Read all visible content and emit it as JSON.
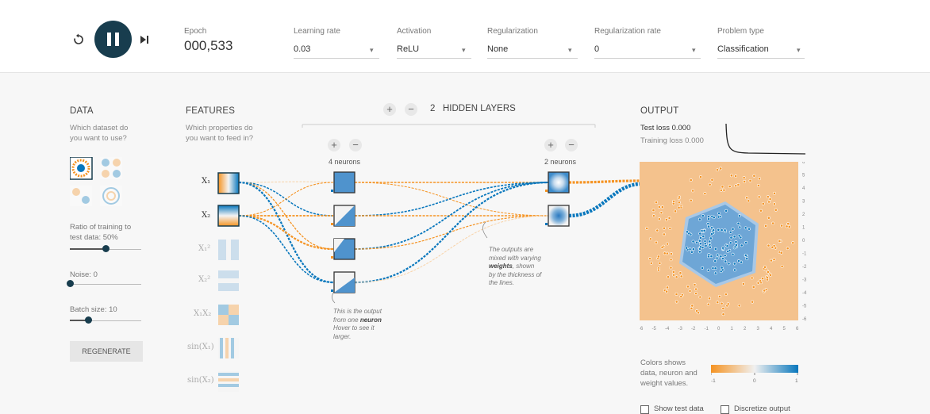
{
  "controls": {
    "reset_icon": "reset-icon",
    "play_pause_icon": "pause-icon",
    "step_icon": "step-icon",
    "epoch": {
      "label": "Epoch",
      "value": "000,533"
    },
    "learning_rate": {
      "label": "Learning rate",
      "value": "0.03"
    },
    "activation": {
      "label": "Activation",
      "value": "ReLU"
    },
    "regularization": {
      "label": "Regularization",
      "value": "None"
    },
    "regularization_rate": {
      "label": "Regularization rate",
      "value": "0"
    },
    "problem_type": {
      "label": "Problem type",
      "value": "Classification"
    }
  },
  "data_panel": {
    "title": "DATA",
    "subtitle_line1": "Which dataset do",
    "subtitle_line2": "you want to use?",
    "ratio_label_line1": "Ratio of training to",
    "ratio_label_line2": "test data:  50%",
    "ratio_value": 0.5,
    "noise_label": "Noise:  0",
    "noise_value": 0,
    "batch_label": "Batch size:  10",
    "batch_value": 0.25,
    "regenerate": "REGENERATE"
  },
  "features_panel": {
    "title": "FEATURES",
    "subtitle_line1": "Which properties do",
    "subtitle_line2": "you want to feed in?",
    "features": [
      "X₁",
      "X₂",
      "X₁²",
      "X₂²",
      "X₁X₂",
      "sin(X₁)",
      "sin(X₂)"
    ]
  },
  "network": {
    "plus": "+",
    "minus": "−",
    "hidden_layers_count": "2",
    "hidden_layers_label": "HIDDEN LAYERS",
    "layer1_neurons": "4 neurons",
    "layer2_neurons": "2 neurons",
    "note_neuron_1": "This is the output",
    "note_neuron_2": "from one",
    "note_neuron_bold": "neuron",
    "note_neuron_3": "Hover to see it",
    "note_neuron_4": "larger.",
    "note_weights_1": "The outputs are",
    "note_weights_2": "mixed with varying",
    "note_weights_bold": "weights",
    "note_weights_3": ", shown",
    "note_weights_4": "by the thickness of",
    "note_weights_5": "the lines."
  },
  "output_panel": {
    "title": "OUTPUT",
    "test_loss": "Test loss 0.000",
    "training_loss": "Training loss 0.000",
    "y_ticks": [
      "6",
      "5",
      "4",
      "3",
      "2",
      "1",
      "0",
      "-1",
      "-2",
      "-3",
      "-4",
      "-5",
      "-6"
    ],
    "x_ticks": [
      "-6",
      "-5",
      "-4",
      "-3",
      "-2",
      "-1",
      "0",
      "1",
      "2",
      "3",
      "4",
      "5",
      "6"
    ],
    "legend_line1": "Colors shows",
    "legend_line2": "data, neuron and",
    "legend_line3": "weight values.",
    "legend_min": "-1",
    "legend_mid": "0",
    "legend_max": "1",
    "show_test_data": "Show test data",
    "discretize_output": "Discretize output"
  },
  "colors": {
    "orange": "#f59322",
    "blue": "#0877bd",
    "dark": "#183d4e"
  }
}
